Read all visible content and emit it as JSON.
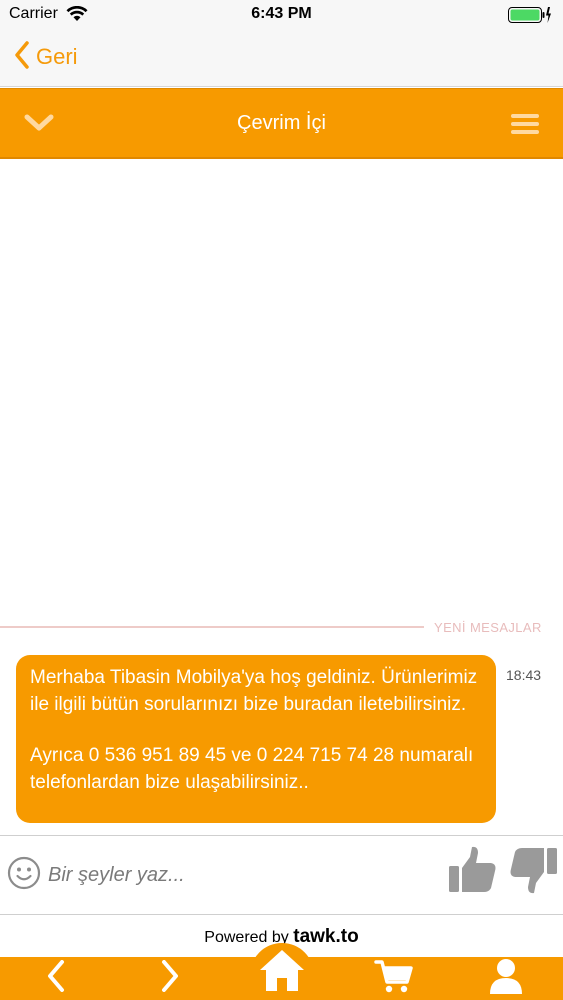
{
  "status_bar": {
    "carrier": "Carrier",
    "time": "6:43 PM"
  },
  "nav": {
    "back_label": "Geri"
  },
  "chat_header": {
    "title": "Çevrim İçi"
  },
  "chat": {
    "divider_label": "YENİ MESAJLAR",
    "messages": [
      {
        "paragraph_1": "Merhaba Tibasin Mobilya'ya hoş geldiniz. Ürünlerimiz ile ilgili bütün sorularınızı bize buradan iletebilirsiniz.",
        "paragraph_2": "Ayrıca 0 536 951 89 45 ve 0 224 715 74 28 numaralı telefonlardan bize ulaşabilirsiniz..",
        "time": "18:43"
      }
    ]
  },
  "composer": {
    "placeholder": "Bir şeyler yaz..."
  },
  "footer": {
    "powered_prefix": "Powered by",
    "powered_brand": "tawk.to"
  },
  "colors": {
    "accent": "#f79a00",
    "nav_tint": "#f59a0a",
    "divider": "#eecbc8",
    "battery_green": "#4cd964"
  },
  "icons": {
    "back": "chevron-left-icon",
    "minimize": "chevron-down-icon",
    "menu": "hamburger-icon",
    "emoji": "smiley-icon",
    "thumb_up": "thumbs-up-icon",
    "thumb_down": "thumbs-down-icon",
    "tab_prev": "chevron-left-icon",
    "tab_next": "chevron-right-icon",
    "tab_home": "home-icon",
    "tab_cart": "cart-icon",
    "tab_user": "user-icon"
  }
}
